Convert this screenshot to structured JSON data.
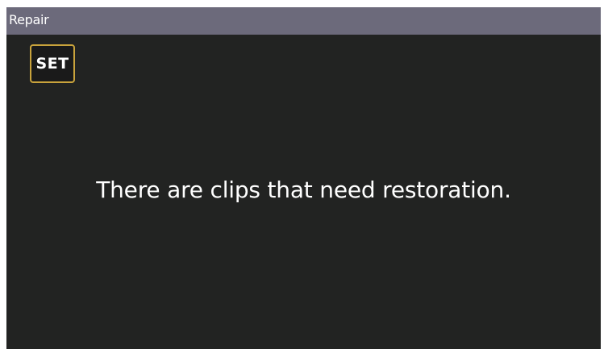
{
  "header": {
    "title": "Repair"
  },
  "controls": {
    "set_label": "SET"
  },
  "main": {
    "message": "There are clips that need restoration."
  },
  "colors": {
    "title_bar": "#6c6a7b",
    "background": "#222322",
    "set_border": "#c9a33c",
    "text": "#ffffff"
  }
}
